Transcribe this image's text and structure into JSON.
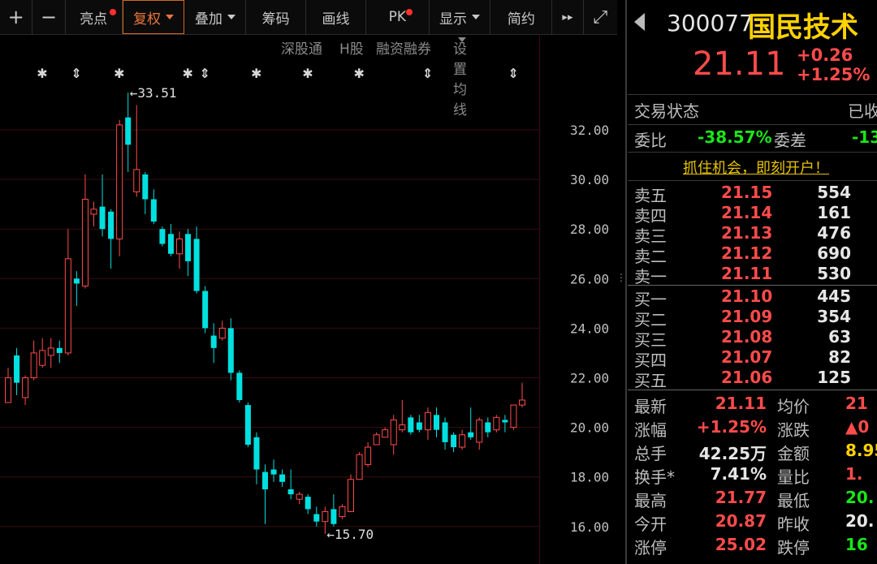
{
  "toolbar": {
    "plus": "+",
    "minus": "−",
    "liangdian": "亮点",
    "fuquan": "复权",
    "diejia": "叠加",
    "chouma": "筹码",
    "huaxian": "画线",
    "pk": "PK",
    "xianshi": "显示",
    "jianyue": "简约",
    "forward": "▸▸",
    "expand": "⤢"
  },
  "subbar": {
    "shengutong": "深股通",
    "hgu": "H股",
    "rongzi": "融资融券",
    "junxian": "设置均线"
  },
  "colors": {
    "up": "#ff4b4b",
    "down": "#00e0e0",
    "grid": "#3a0d0d",
    "bg": "#000000"
  },
  "chart_data": {
    "type": "candlestick",
    "ylim": [
      15.3,
      34.6
    ],
    "y_ticks": [
      "32.00",
      "30.00",
      "28.00",
      "26.00",
      "24.00",
      "22.00",
      "20.00",
      "18.00",
      "16.00"
    ],
    "high_label": "33.51",
    "low_label": "15.70",
    "candles": [
      {
        "o": 21.0,
        "c": 22.0,
        "h": 22.4,
        "l": 21.0
      },
      {
        "o": 22.9,
        "c": 21.8,
        "h": 23.2,
        "l": 21.3
      },
      {
        "o": 21.2,
        "c": 22.0,
        "h": 22.1,
        "l": 20.9
      },
      {
        "o": 22.0,
        "c": 23.0,
        "h": 23.5,
        "l": 21.9
      },
      {
        "o": 22.5,
        "c": 23.1,
        "h": 23.6,
        "l": 22.4
      },
      {
        "o": 22.9,
        "c": 23.2,
        "h": 23.6,
        "l": 22.4
      },
      {
        "o": 23.2,
        "c": 23.0,
        "h": 23.5,
        "l": 22.6
      },
      {
        "o": 23.0,
        "c": 26.8,
        "h": 28.0,
        "l": 22.9
      },
      {
        "o": 26.0,
        "c": 25.8,
        "h": 26.3,
        "l": 24.9
      },
      {
        "o": 25.7,
        "c": 29.2,
        "h": 30.2,
        "l": 25.6
      },
      {
        "o": 28.6,
        "c": 28.8,
        "h": 29.1,
        "l": 28.1
      },
      {
        "o": 28.9,
        "c": 28.0,
        "h": 30.2,
        "l": 27.7
      },
      {
        "o": 28.7,
        "c": 27.6,
        "h": 28.8,
        "l": 26.4
      },
      {
        "o": 27.6,
        "c": 32.2,
        "h": 32.4,
        "l": 26.9
      },
      {
        "o": 32.5,
        "c": 31.4,
        "h": 33.5,
        "l": 30.3
      },
      {
        "o": 29.5,
        "c": 30.4,
        "h": 33.0,
        "l": 29.3
      },
      {
        "o": 30.2,
        "c": 29.2,
        "h": 30.3,
        "l": 28.6
      },
      {
        "o": 29.2,
        "c": 28.3,
        "h": 29.6,
        "l": 28.2
      },
      {
        "o": 28.0,
        "c": 27.4,
        "h": 28.1,
        "l": 27.3
      },
      {
        "o": 27.8,
        "c": 27.0,
        "h": 28.2,
        "l": 26.9
      },
      {
        "o": 27.0,
        "c": 27.6,
        "h": 27.9,
        "l": 26.4
      },
      {
        "o": 27.8,
        "c": 26.7,
        "h": 28.0,
        "l": 26.1
      },
      {
        "o": 27.6,
        "c": 25.5,
        "h": 28.1,
        "l": 25.4
      },
      {
        "o": 25.5,
        "c": 24.0,
        "h": 25.7,
        "l": 23.8
      },
      {
        "o": 23.7,
        "c": 23.2,
        "h": 24.2,
        "l": 22.6
      },
      {
        "o": 23.6,
        "c": 24.0,
        "h": 24.3,
        "l": 23.5
      },
      {
        "o": 24.0,
        "c": 22.2,
        "h": 24.4,
        "l": 21.9
      },
      {
        "o": 22.2,
        "c": 21.1,
        "h": 22.3,
        "l": 21.0
      },
      {
        "o": 20.9,
        "c": 19.3,
        "h": 21.0,
        "l": 19.2
      },
      {
        "o": 19.6,
        "c": 18.3,
        "h": 19.8,
        "l": 17.7
      },
      {
        "o": 18.2,
        "c": 17.5,
        "h": 18.5,
        "l": 16.1
      },
      {
        "o": 18.3,
        "c": 18.1,
        "h": 18.7,
        "l": 17.8
      },
      {
        "o": 18.1,
        "c": 17.8,
        "h": 18.3,
        "l": 17.6
      },
      {
        "o": 17.5,
        "c": 17.3,
        "h": 18.3,
        "l": 17.1
      },
      {
        "o": 17.1,
        "c": 17.3,
        "h": 17.4,
        "l": 16.9
      },
      {
        "o": 17.2,
        "c": 16.7,
        "h": 17.3,
        "l": 16.5
      },
      {
        "o": 16.5,
        "c": 16.2,
        "h": 16.8,
        "l": 16.0
      },
      {
        "o": 16.2,
        "c": 16.6,
        "h": 16.8,
        "l": 15.7
      },
      {
        "o": 16.7,
        "c": 16.1,
        "h": 17.3,
        "l": 16.0
      },
      {
        "o": 16.4,
        "c": 16.8,
        "h": 16.9,
        "l": 16.3
      },
      {
        "o": 16.6,
        "c": 17.9,
        "h": 18.1,
        "l": 16.6
      },
      {
        "o": 17.9,
        "c": 18.9,
        "h": 19.0,
        "l": 17.9
      },
      {
        "o": 18.5,
        "c": 19.2,
        "h": 19.4,
        "l": 18.4
      },
      {
        "o": 19.3,
        "c": 19.7,
        "h": 19.8,
        "l": 19.3
      },
      {
        "o": 19.6,
        "c": 19.9,
        "h": 20.0,
        "l": 19.6
      },
      {
        "o": 19.3,
        "c": 20.3,
        "h": 20.5,
        "l": 18.9
      },
      {
        "o": 19.9,
        "c": 20.1,
        "h": 21.1,
        "l": 19.8
      },
      {
        "o": 20.4,
        "c": 19.8,
        "h": 20.5,
        "l": 19.7
      },
      {
        "o": 20.2,
        "c": 19.9,
        "h": 20.5,
        "l": 19.8
      },
      {
        "o": 19.9,
        "c": 20.6,
        "h": 20.8,
        "l": 19.5
      },
      {
        "o": 20.5,
        "c": 19.9,
        "h": 20.8,
        "l": 19.6
      },
      {
        "o": 20.2,
        "c": 19.4,
        "h": 20.4,
        "l": 19.1
      },
      {
        "o": 19.7,
        "c": 19.2,
        "h": 19.8,
        "l": 19.0
      },
      {
        "o": 19.2,
        "c": 19.7,
        "h": 19.9,
        "l": 19.1
      },
      {
        "o": 19.8,
        "c": 19.6,
        "h": 20.8,
        "l": 19.5
      },
      {
        "o": 19.4,
        "c": 20.3,
        "h": 20.4,
        "l": 19.1
      },
      {
        "o": 20.2,
        "c": 19.8,
        "h": 20.4,
        "l": 19.6
      },
      {
        "o": 19.9,
        "c": 20.4,
        "h": 20.5,
        "l": 19.8
      },
      {
        "o": 20.3,
        "c": 20.2,
        "h": 20.5,
        "l": 19.8
      },
      {
        "o": 20.0,
        "c": 20.9,
        "h": 20.9,
        "l": 19.9
      },
      {
        "o": 20.9,
        "c": 21.1,
        "h": 21.8,
        "l": 20.8
      }
    ],
    "event_markers": [
      {
        "i": 4,
        "sym": "✱"
      },
      {
        "i": 8,
        "sym": "⇕"
      },
      {
        "i": 13,
        "sym": "✱"
      },
      {
        "i": 21,
        "sym": "✱"
      },
      {
        "i": 23,
        "sym": "⇕"
      },
      {
        "i": 29,
        "sym": "✱"
      },
      {
        "i": 35,
        "sym": "✱"
      },
      {
        "i": 41,
        "sym": "✱"
      },
      {
        "i": 49,
        "sym": "⇕"
      },
      {
        "i": 59,
        "sym": "⇕"
      }
    ]
  },
  "header": {
    "code": "300077",
    "name": "国民技术",
    "price": "21.11",
    "change": "+0.26",
    "pct": "+1.25%"
  },
  "status": {
    "label": "交易状态",
    "value": "已收"
  },
  "weibi": {
    "label": "委比",
    "value": "-38.57%",
    "diff_label": "委差",
    "diff_value": "-13"
  },
  "promo": "抓住机会，即刻开户！",
  "sell": [
    {
      "label": "卖五",
      "price": "21.15",
      "vol": "554"
    },
    {
      "label": "卖四",
      "price": "21.14",
      "vol": "161"
    },
    {
      "label": "卖三",
      "price": "21.13",
      "vol": "476"
    },
    {
      "label": "卖二",
      "price": "21.12",
      "vol": "690"
    },
    {
      "label": "卖一",
      "price": "21.11",
      "vol": "530"
    }
  ],
  "buy": [
    {
      "label": "买一",
      "price": "21.10",
      "vol": "445"
    },
    {
      "label": "买二",
      "price": "21.09",
      "vol": "354"
    },
    {
      "label": "买三",
      "price": "21.08",
      "vol": "63"
    },
    {
      "label": "买四",
      "price": "21.07",
      "vol": "82"
    },
    {
      "label": "买五",
      "price": "21.06",
      "vol": "125"
    }
  ],
  "stats": [
    {
      "l1": "最新",
      "v1": "21.11",
      "c1": "red",
      "l2": "均价",
      "v2": "21",
      "c2": "red"
    },
    {
      "l1": "涨幅",
      "v1": "+1.25%",
      "c1": "red",
      "l2": "涨跌",
      "v2": "▲0",
      "c2": "red"
    },
    {
      "l1": "总手",
      "v1": "42.25万",
      "c1": "white",
      "l2": "金额",
      "v2": "8.95",
      "c2": "yellow"
    },
    {
      "l1": "换手*",
      "v1": "7.41%",
      "c1": "white",
      "l2": "量比",
      "v2": "1.",
      "c2": "red"
    },
    {
      "l1": "最高",
      "v1": "21.77",
      "c1": "red",
      "l2": "最低",
      "v2": "20.",
      "c2": "green"
    },
    {
      "l1": "今开",
      "v1": "20.87",
      "c1": "red",
      "l2": "昨收",
      "v2": "20.",
      "c2": "white"
    },
    {
      "l1": "涨停",
      "v1": "25.02",
      "c1": "red",
      "l2": "跌停",
      "v2": "16",
      "c2": "green"
    }
  ]
}
